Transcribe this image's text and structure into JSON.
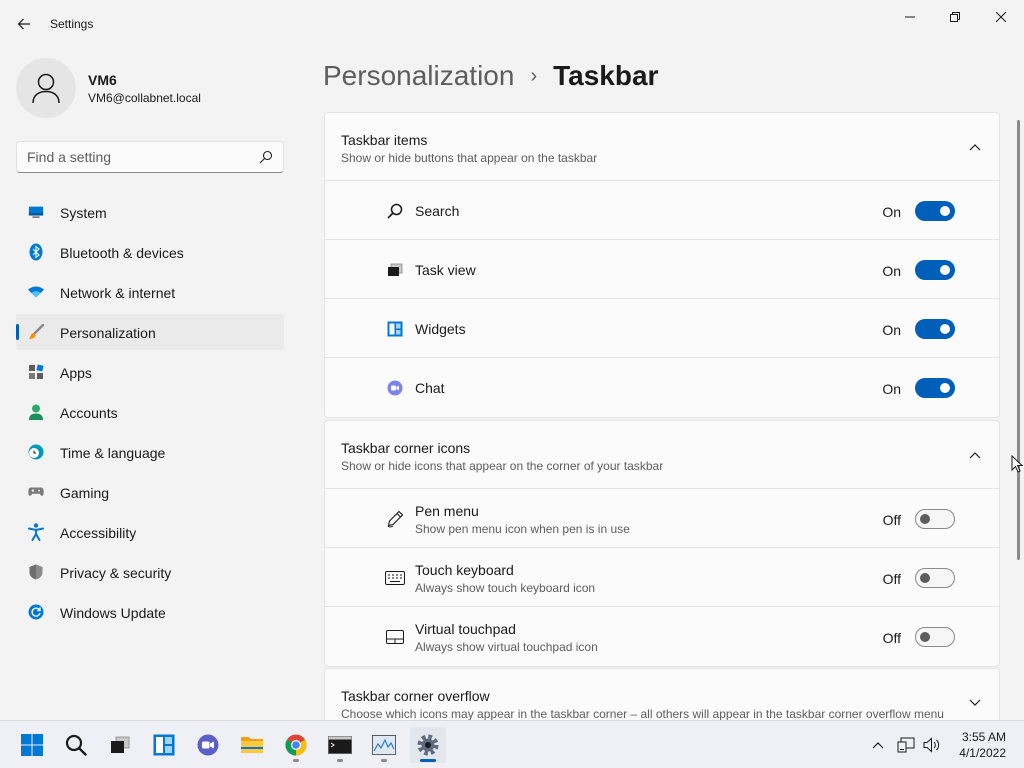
{
  "window": {
    "title": "Settings"
  },
  "profile": {
    "name": "VM6",
    "email": "VM6@collabnet.local"
  },
  "search": {
    "placeholder": "Find a setting"
  },
  "sidebar": {
    "items": [
      {
        "label": "System",
        "icon": "system-icon"
      },
      {
        "label": "Bluetooth & devices",
        "icon": "bluetooth-icon"
      },
      {
        "label": "Network & internet",
        "icon": "wifi-icon"
      },
      {
        "label": "Personalization",
        "icon": "brush-icon",
        "active": true
      },
      {
        "label": "Apps",
        "icon": "apps-icon"
      },
      {
        "label": "Accounts",
        "icon": "person-icon"
      },
      {
        "label": "Time & language",
        "icon": "clock-globe-icon"
      },
      {
        "label": "Gaming",
        "icon": "gamepad-icon"
      },
      {
        "label": "Accessibility",
        "icon": "accessibility-icon"
      },
      {
        "label": "Privacy & security",
        "icon": "shield-icon"
      },
      {
        "label": "Windows Update",
        "icon": "update-icon"
      }
    ]
  },
  "breadcrumb": {
    "parent": "Personalization",
    "separator": "›",
    "current": "Taskbar"
  },
  "sections": [
    {
      "title": "Taskbar items",
      "subtitle": "Show or hide buttons that appear on the taskbar",
      "expanded": true,
      "rows": [
        {
          "label": "Search",
          "state": "On",
          "on": true,
          "icon": "search-icon"
        },
        {
          "label": "Task view",
          "state": "On",
          "on": true,
          "icon": "task-view-icon"
        },
        {
          "label": "Widgets",
          "state": "On",
          "on": true,
          "icon": "widgets-icon"
        },
        {
          "label": "Chat",
          "state": "On",
          "on": true,
          "icon": "chat-icon"
        }
      ]
    },
    {
      "title": "Taskbar corner icons",
      "subtitle": "Show or hide icons that appear on the corner of your taskbar",
      "expanded": true,
      "rows": [
        {
          "label": "Pen menu",
          "sub": "Show pen menu icon when pen is in use",
          "state": "Off",
          "on": false,
          "icon": "pen-icon"
        },
        {
          "label": "Touch keyboard",
          "sub": "Always show touch keyboard icon",
          "state": "Off",
          "on": false,
          "icon": "keyboard-icon"
        },
        {
          "label": "Virtual touchpad",
          "sub": "Always show virtual touchpad icon",
          "state": "Off",
          "on": false,
          "icon": "touchpad-icon"
        }
      ]
    },
    {
      "title": "Taskbar corner overflow",
      "subtitle": "Choose which icons may appear in the taskbar corner – all others will appear in the taskbar corner overflow menu",
      "expanded": false
    }
  ],
  "taskbar": {
    "apps": [
      "start-icon",
      "search-icon",
      "task-view-icon",
      "widgets-icon",
      "chat-icon",
      "file-explorer-icon",
      "chrome-icon",
      "terminal-icon",
      "resource-monitor-icon",
      "settings-icon"
    ],
    "time": "3:55 AM",
    "date": "4/1/2022"
  },
  "colors": {
    "accent": "#005fb8",
    "background": "#f3f3f3",
    "card": "#fbfbfb"
  }
}
